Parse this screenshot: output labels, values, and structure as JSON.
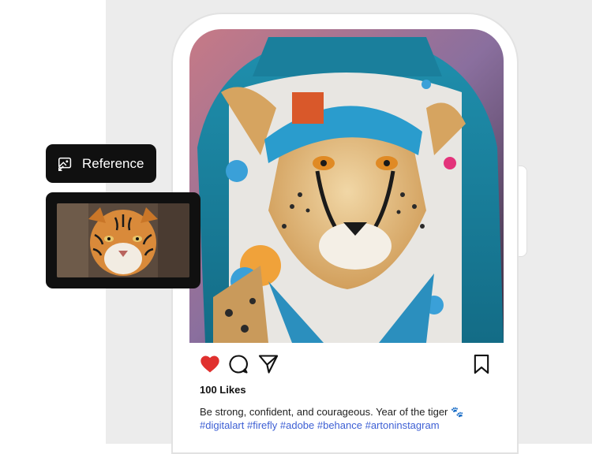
{
  "reference": {
    "label": "Reference",
    "icon": "image-reference-icon"
  },
  "reference_thumbnail": {
    "subject": "tiger-photo"
  },
  "post": {
    "image_subject": "cheetah-jacket-art",
    "likes": "100 Likes",
    "caption": "Be strong, confident, and courageous. Year of the tiger 🐾",
    "hashtags": "#digitalart #firefly #adobe #behance #artoninstagram",
    "liked": true
  },
  "actions": {
    "like_icon": "heart-icon",
    "comment_icon": "comment-icon",
    "share_icon": "send-icon",
    "save_icon": "bookmark-icon"
  },
  "colors": {
    "heart": "#e0302e",
    "hashtag": "#3d5fd4",
    "panel_bg": "#ececec",
    "dark_chip": "#101010",
    "jacket": "#1d8aa6"
  }
}
